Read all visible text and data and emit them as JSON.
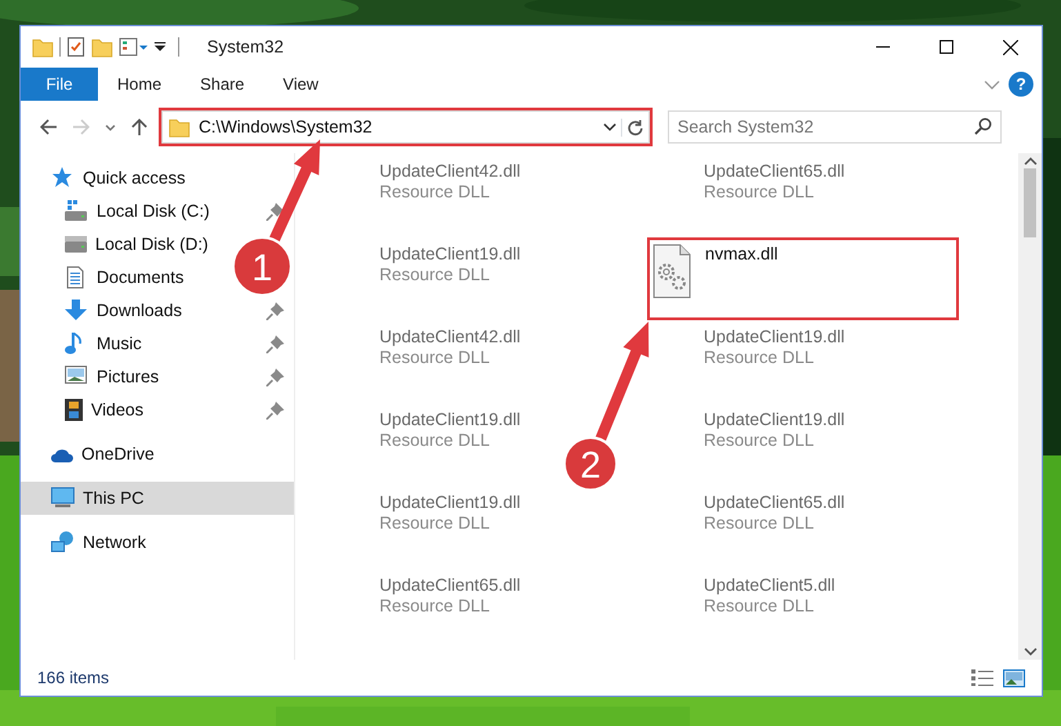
{
  "window": {
    "title": "System32"
  },
  "ribbon_tabs": [
    {
      "label": "File",
      "kind": "file"
    },
    {
      "label": "Home",
      "kind": "tab"
    },
    {
      "label": "Share",
      "kind": "tab"
    },
    {
      "label": "View",
      "kind": "tab"
    }
  ],
  "help": "?",
  "address": {
    "path": "C:\\Windows\\System32",
    "highlighted": true
  },
  "search": {
    "placeholder": "Search System32"
  },
  "navigation": [
    {
      "label": "Quick access",
      "kind": "star",
      "selected": false,
      "children": [
        {
          "label": "Local Disk (C:)",
          "kind": "windisk",
          "pinned": true,
          "selected": false
        },
        {
          "label": "Local Disk (D:)",
          "kind": "disk",
          "pinned": false,
          "selected": false
        },
        {
          "label": "Documents",
          "kind": "documents",
          "pinned": false,
          "selected": false
        },
        {
          "label": "Downloads",
          "kind": "downloads",
          "pinned": true,
          "selected": false
        },
        {
          "label": "Music",
          "kind": "music",
          "pinned": true,
          "selected": false
        },
        {
          "label": "Pictures",
          "kind": "pictures",
          "pinned": true,
          "selected": false
        },
        {
          "label": "Videos",
          "kind": "videos",
          "pinned": true,
          "selected": false
        }
      ]
    },
    {
      "label": "OneDrive",
      "kind": "cloud",
      "selected": false
    },
    {
      "label": "This PC",
      "kind": "pc",
      "selected": true
    },
    {
      "label": "Network",
      "kind": "network",
      "selected": false
    }
  ],
  "files": [
    {
      "name": "UpdateClient42.dll",
      "type": "Resource DLL",
      "blurred": true,
      "highlighted": false
    },
    {
      "name": "UpdateClient65.dll",
      "type": "Resource DLL",
      "blurred": true,
      "highlighted": false
    },
    {
      "name": "UpdateClient19.dll",
      "type": "Resource DLL",
      "blurred": true,
      "highlighted": false
    },
    {
      "name": "nvmax.dll",
      "blurred": false,
      "highlighted": true
    },
    {
      "name": "UpdateClient42.dll",
      "type": "Resource DLL",
      "blurred": true,
      "highlighted": false
    },
    {
      "name": "UpdateClient19.dll",
      "type": "Resource DLL",
      "blurred": true,
      "highlighted": false
    },
    {
      "name": "UpdateClient19.dll",
      "type": "Resource DLL",
      "blurred": true,
      "highlighted": false
    },
    {
      "name": "UpdateClient19.dll",
      "type": "Resource DLL",
      "blurred": true,
      "highlighted": false
    },
    {
      "name": "UpdateClient19.dll",
      "type": "Resource DLL",
      "blurred": true,
      "highlighted": false
    },
    {
      "name": "UpdateClient65.dll",
      "type": "Resource DLL",
      "blurred": true,
      "highlighted": false
    },
    {
      "name": "UpdateClient65.dll",
      "type": "Resource DLL",
      "blurred": true,
      "highlighted": false
    },
    {
      "name": "UpdateClient5.dll",
      "type": "Resource DLL",
      "blurred": true,
      "highlighted": false
    }
  ],
  "status_bar": {
    "items": "166 items"
  },
  "callouts": [
    {
      "number": "1"
    },
    {
      "number": "2"
    }
  ]
}
